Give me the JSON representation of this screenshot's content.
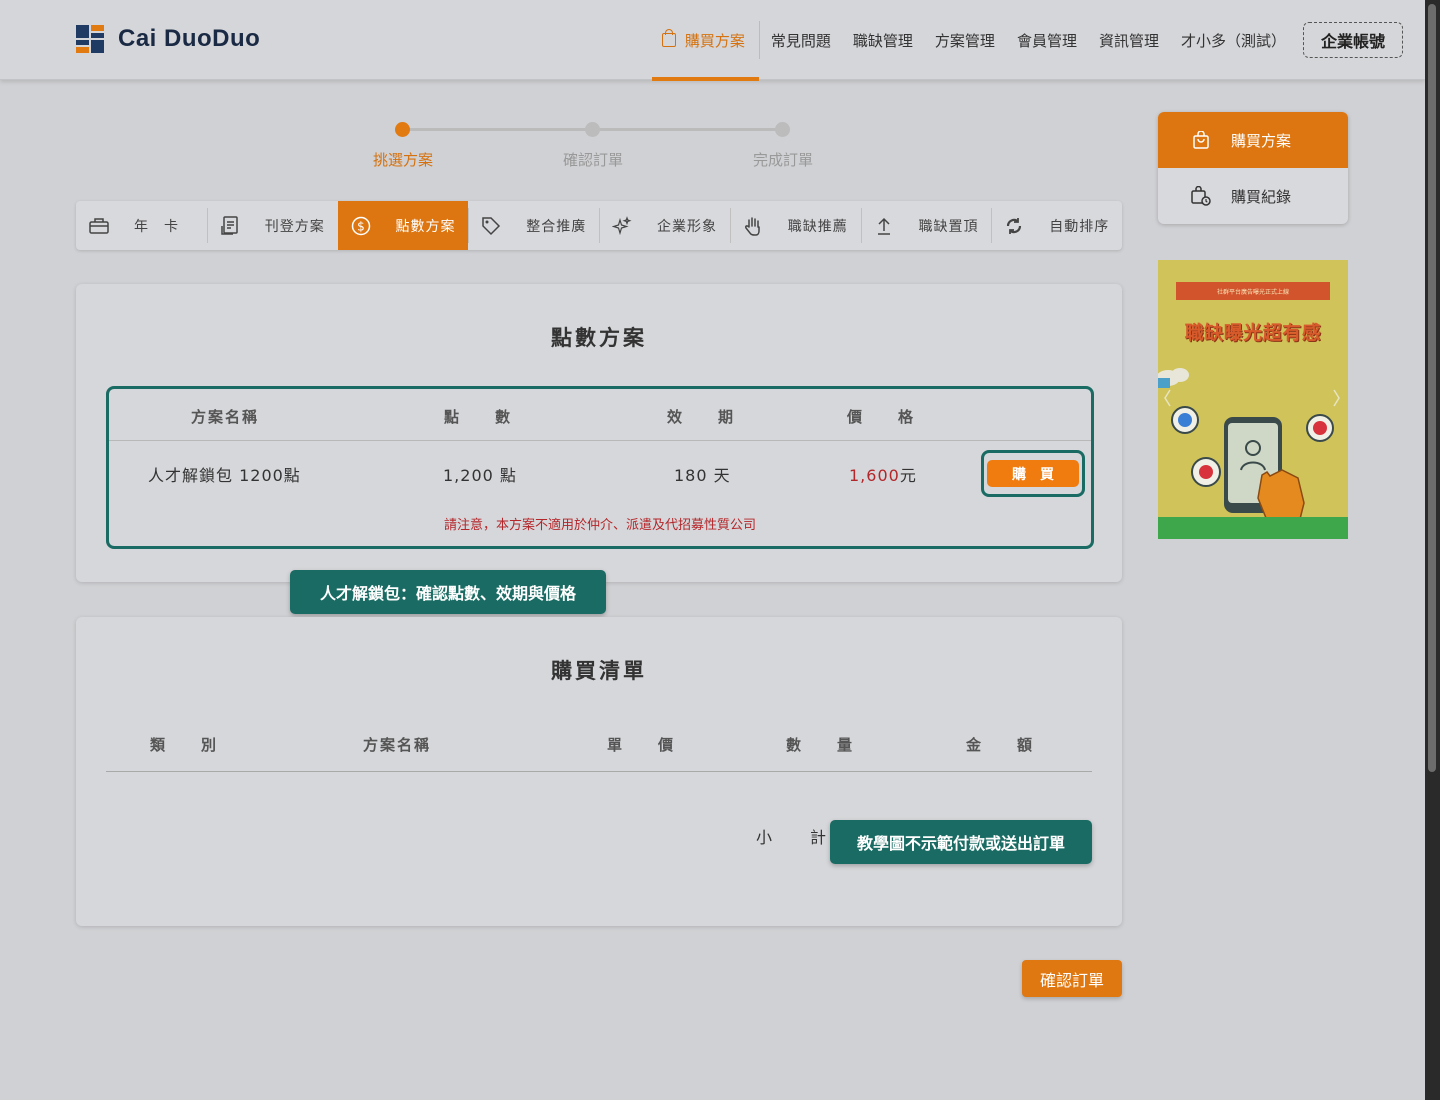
{
  "header": {
    "logo_text": "Cai DuoDuo",
    "nav": {
      "buy_plan": "購買方案",
      "faq": "常見問題",
      "vacancy_mgmt": "職缺管理",
      "plan_mgmt": "方案管理",
      "member_mgmt": "會員管理",
      "info_mgmt": "資訊管理",
      "user": "才小多（測試）",
      "biz_account": "企業帳號"
    }
  },
  "stepper": {
    "steps": [
      {
        "label": "挑選方案",
        "active": true
      },
      {
        "label": "確認訂單",
        "active": false
      },
      {
        "label": "完成訂單",
        "active": false
      }
    ]
  },
  "tabs": [
    {
      "label": "年　卡",
      "icon": "card-icon",
      "active": false
    },
    {
      "label": "刊登方案",
      "icon": "document-icon",
      "active": false
    },
    {
      "label": "點數方案",
      "icon": "dollar-icon",
      "active": true
    },
    {
      "label": "整合推廣",
      "icon": "tag-icon",
      "active": false
    },
    {
      "label": "企業形象",
      "icon": "sparkle-icon",
      "active": false
    },
    {
      "label": "職缺推薦",
      "icon": "hand-icon",
      "active": false
    },
    {
      "label": "職缺置頂",
      "icon": "arrow-up-icon",
      "active": false
    },
    {
      "label": "自動排序",
      "icon": "refresh-icon",
      "active": false
    }
  ],
  "points_plan": {
    "title": "點數方案",
    "headers": {
      "name": "方案名稱",
      "points": "點　　數",
      "validity": "效　　期",
      "price": "價　　格"
    },
    "row": {
      "name": "人才解鎖包 1200點",
      "points": "1,200 點",
      "validity": "180 天",
      "price_value": "1,600",
      "price_unit": "元",
      "buy_label": "購買"
    },
    "note": "請注意，本方案不適用於仲介、派遣及代招募性質公司"
  },
  "callouts": {
    "plan": "人才解鎖包：確認點數、效期與價格",
    "payment": "教學圖不示範付款或送出訂單"
  },
  "purchase_list": {
    "title": "購買清單",
    "headers": {
      "category": "類　　別",
      "name": "方案名稱",
      "unit_price": "單　　價",
      "quantity": "數　　量",
      "amount": "金　　額"
    },
    "subtotal_label": "小　　計"
  },
  "confirm_label": "確認訂單",
  "side_menu": {
    "buy_plan": "購買方案",
    "history": "購買紀錄"
  },
  "ad": {
    "banner": "社群平台廣告曝光正式上線",
    "title": "職缺曝光超有感"
  },
  "colors": {
    "accent": "#dd7611",
    "highlight": "#1a6b63",
    "warning": "#b3262a"
  }
}
